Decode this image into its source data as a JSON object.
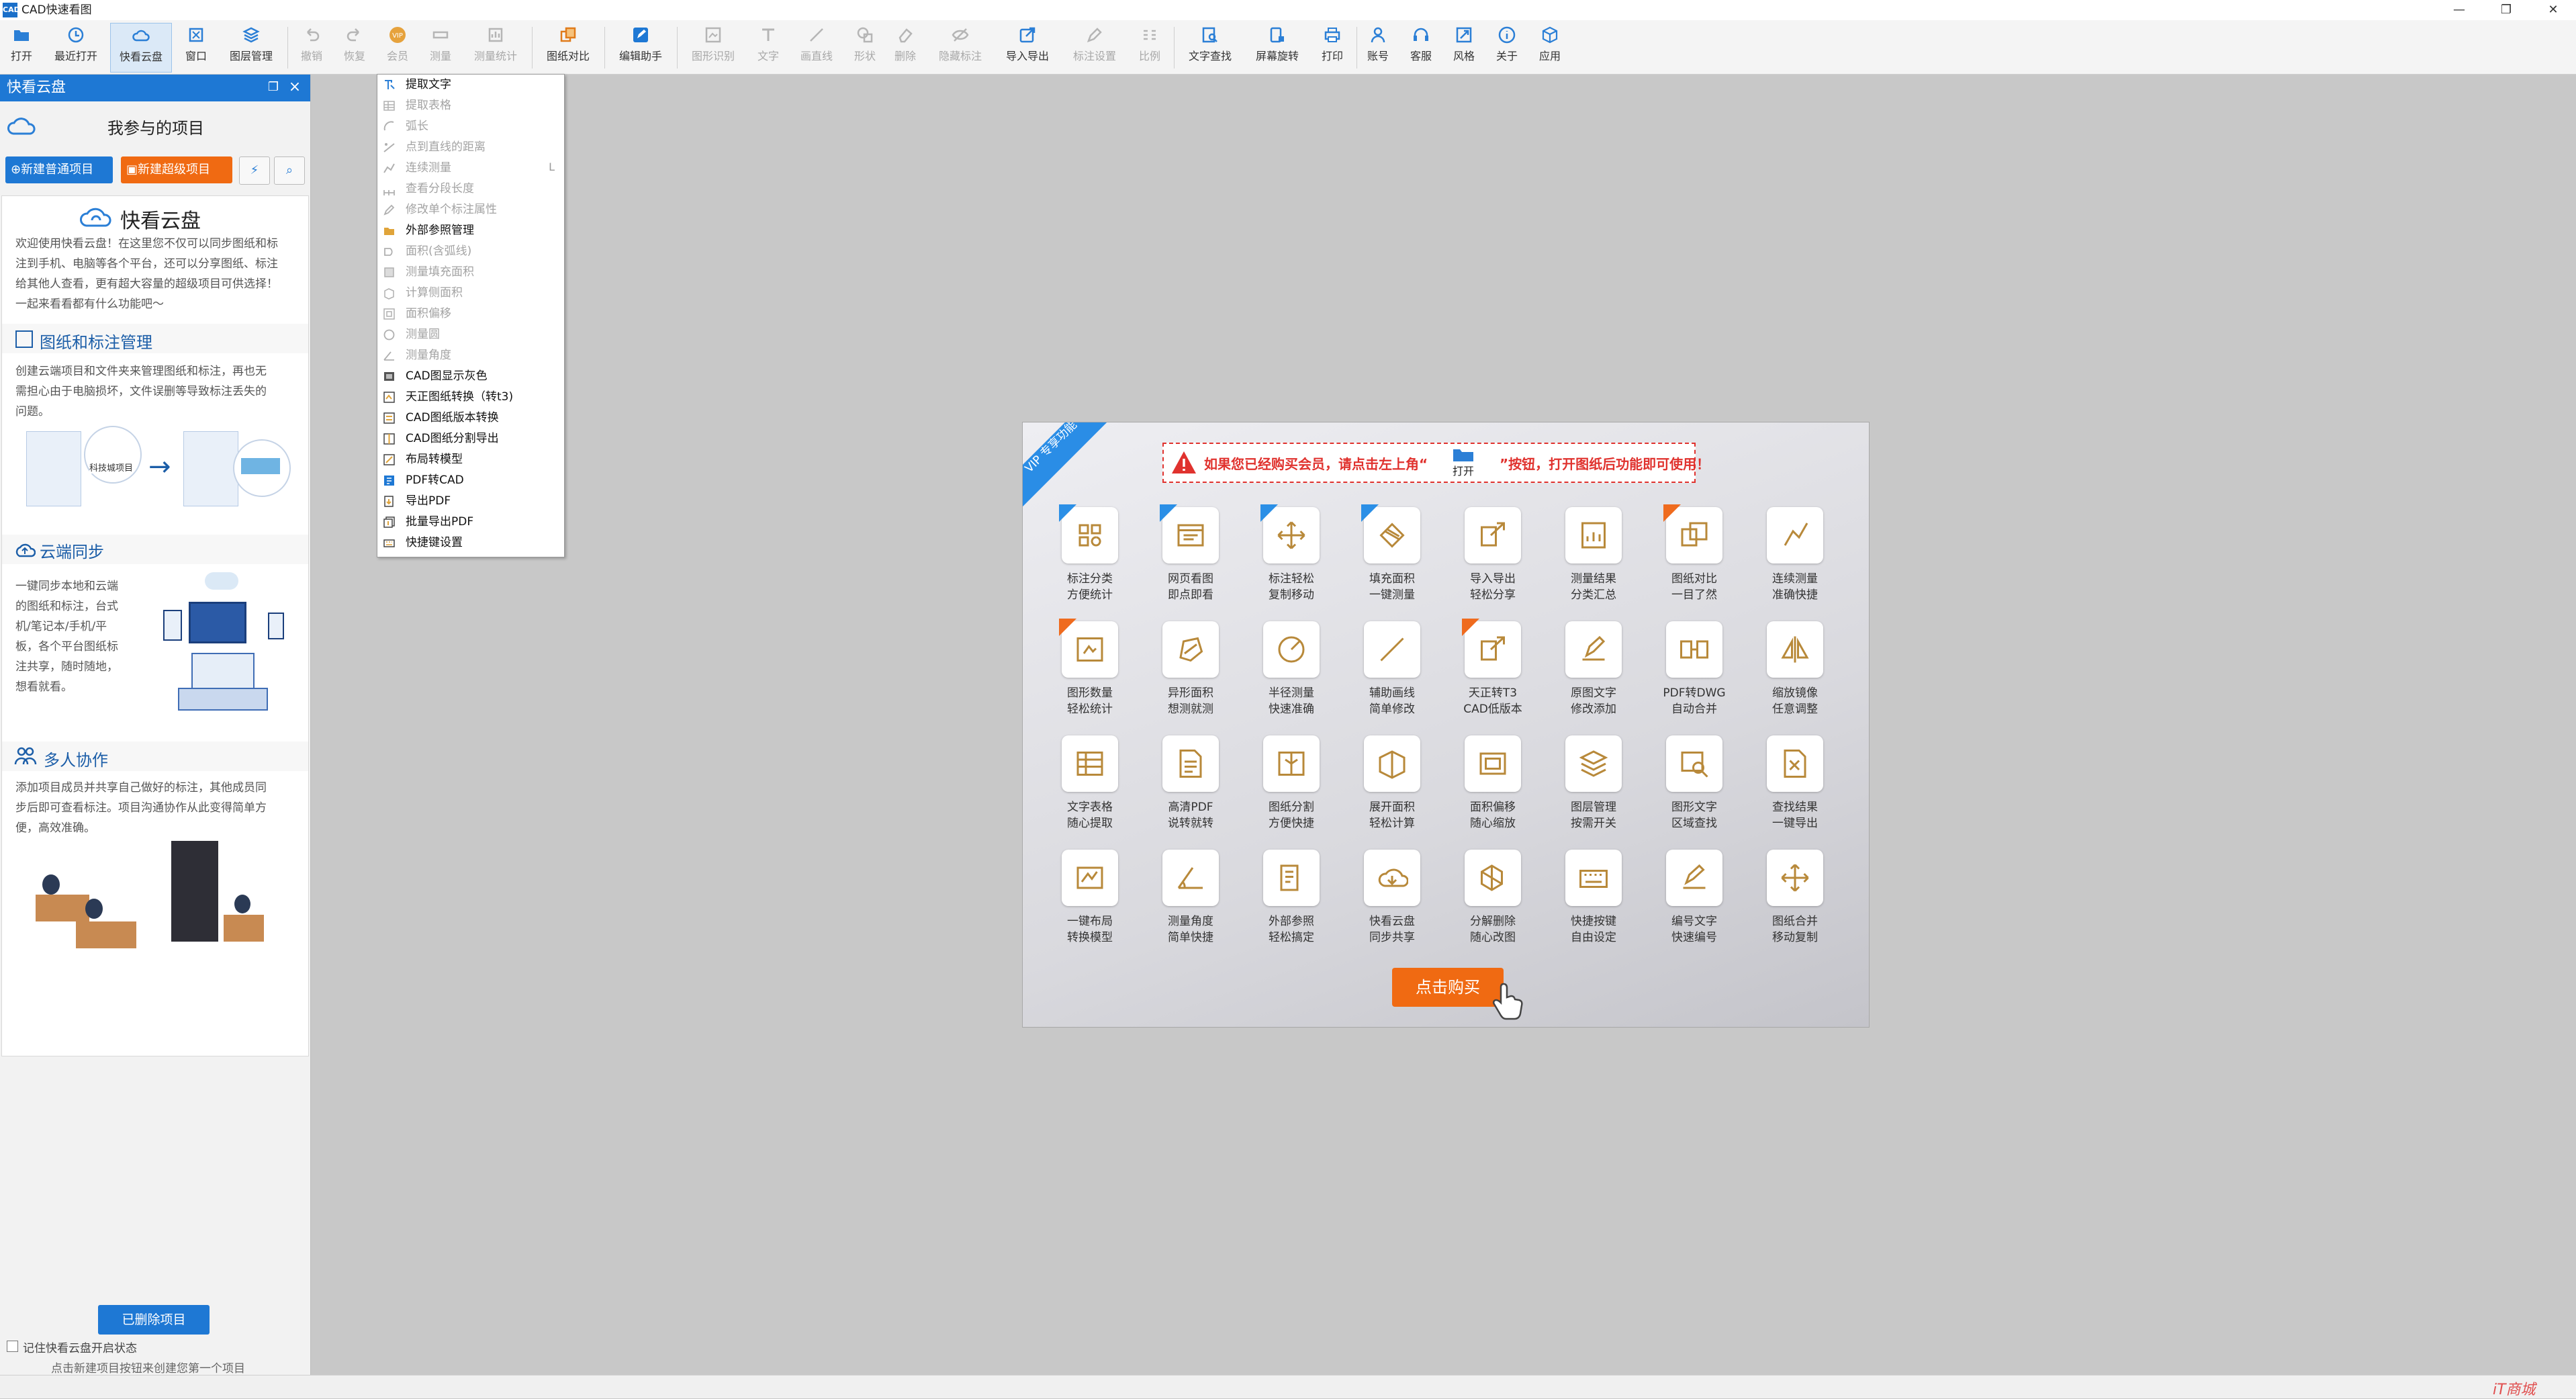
{
  "app": {
    "icon_text": "CAD",
    "title": "CAD快速看图"
  },
  "window": {
    "minimize": "—",
    "restore": "❐",
    "close": "✕"
  },
  "toolbar": [
    {
      "label": "打开",
      "icon": "folder-icon",
      "enabled": true
    },
    {
      "label": "最近打开",
      "icon": "clock-icon",
      "enabled": true
    },
    {
      "label": "快看云盘",
      "icon": "cloud-icon",
      "enabled": true,
      "active": true
    },
    {
      "label": "窗口",
      "icon": "window-icon",
      "enabled": true
    },
    {
      "label": "图层管理",
      "icon": "layers-icon",
      "enabled": true
    },
    {
      "label": "撤销",
      "icon": "undo-icon",
      "enabled": false
    },
    {
      "label": "恢复",
      "icon": "redo-icon",
      "enabled": false
    },
    {
      "label": "会员",
      "icon": "vip-icon",
      "enabled": false
    },
    {
      "label": "测量",
      "icon": "measure-icon",
      "enabled": false
    },
    {
      "label": "测量统计",
      "icon": "measure-stats-icon",
      "enabled": false
    },
    {
      "label": "图纸对比",
      "icon": "compare-icon",
      "enabled": true
    },
    {
      "label": "编辑助手",
      "icon": "edit-assistant-icon",
      "enabled": true
    },
    {
      "label": "图形识别",
      "icon": "shape-recognize-icon",
      "enabled": false
    },
    {
      "label": "文字",
      "icon": "text-icon",
      "enabled": false
    },
    {
      "label": "画直线",
      "icon": "line-icon",
      "enabled": false
    },
    {
      "label": "形状",
      "icon": "shape-icon",
      "enabled": false
    },
    {
      "label": "删除",
      "icon": "erase-icon",
      "enabled": false
    },
    {
      "label": "隐藏标注",
      "icon": "hide-annotation-icon",
      "enabled": false
    },
    {
      "label": "导入导出",
      "icon": "import-export-icon",
      "enabled": true
    },
    {
      "label": "标注设置",
      "icon": "annotation-settings-icon",
      "enabled": false
    },
    {
      "label": "比例",
      "icon": "scale-icon",
      "enabled": false
    },
    {
      "label": "文字查找",
      "icon": "text-search-icon",
      "enabled": true
    },
    {
      "label": "屏幕旋转",
      "icon": "rotate-screen-icon",
      "enabled": true
    },
    {
      "label": "打印",
      "icon": "printer-icon",
      "enabled": true
    },
    {
      "label": "账号",
      "icon": "account-icon",
      "enabled": true
    },
    {
      "label": "客服",
      "icon": "headset-icon",
      "enabled": true
    },
    {
      "label": "风格",
      "icon": "style-icon",
      "enabled": true
    },
    {
      "label": "关于",
      "icon": "info-icon",
      "enabled": true
    },
    {
      "label": "应用",
      "icon": "apps-icon",
      "enabled": true
    }
  ],
  "panel": {
    "title": "快看云盘",
    "project_title": "我参与的项目",
    "new_normal": "新建普通项目",
    "new_super": "新建超级项目",
    "card_title": "快看云盘",
    "intro": [
      "欢迎使用快看云盘！在这里您不仅可以同步图纸和标",
      "注到手机、电脑等各个平台，还可以分享图纸、标注",
      "给其他人查看，更有超大容量的超级项目可供选择！",
      "一起来看看都有什么功能吧～"
    ],
    "sec1_title": "图纸和标注管理",
    "sec1_text": [
      "创建云端项目和文件夹来管理图纸和标注，再也无",
      "需担心由于电脑损坏，文件误删等导致标注丢失的",
      "问题。"
    ],
    "sec1_thumb_label": "科技城项目",
    "sec2_title": "云端同步",
    "sec2_text": [
      "一键同步本地和云端",
      "的图纸和标注，台式",
      "机/笔记本/手机/平",
      "板，各个平台图纸标",
      "注共享，随时随地，",
      "想看就看。"
    ],
    "sec3_title": "多人协作",
    "sec3_text": [
      "添加项目成员并共享自己做好的标注，其他成员同",
      "步后即可查看标注。项目沟通协作从此变得简单方",
      "便，高效准确。"
    ],
    "deleted_btn": "已删除项目",
    "remember": "记住快看云盘开启状态",
    "hint": "点击新建项目按钮来创建您第一个项目"
  },
  "menu": [
    {
      "label": "提取文字",
      "enabled": true,
      "icon": "extract-text-icon"
    },
    {
      "label": "提取表格",
      "enabled": false,
      "icon": "extract-table-icon"
    },
    {
      "label": "弧长",
      "enabled": false,
      "icon": "arc-length-icon"
    },
    {
      "label": "点到直线的距离",
      "enabled": false,
      "icon": "point-line-distance-icon"
    },
    {
      "label": "连续测量",
      "enabled": false,
      "icon": "continuous-measure-icon",
      "shortcut": "L"
    },
    {
      "label": "查看分段长度",
      "enabled": false,
      "icon": "segment-length-icon"
    },
    {
      "label": "修改单个标注属性",
      "enabled": false,
      "icon": "edit-annotation-icon"
    },
    {
      "label": "外部参照管理",
      "enabled": true,
      "icon": "xref-icon"
    },
    {
      "label": "面积(含弧线)",
      "enabled": false,
      "icon": "area-arc-icon"
    },
    {
      "label": "测量填充面积",
      "enabled": false,
      "icon": "fill-area-icon"
    },
    {
      "label": "计算侧面积",
      "enabled": false,
      "icon": "side-area-icon"
    },
    {
      "label": "面积偏移",
      "enabled": false,
      "icon": "area-offset-icon"
    },
    {
      "label": "测量圆",
      "enabled": false,
      "icon": "measure-circle-icon"
    },
    {
      "label": "测量角度",
      "enabled": false,
      "icon": "measure-angle-icon"
    },
    {
      "label": "CAD图显示灰色",
      "enabled": true,
      "icon": "gray-display-icon"
    },
    {
      "label": "天正图纸转换（转t3)",
      "enabled": true,
      "icon": "tangent-convert-icon"
    },
    {
      "label": "CAD图纸版本转换",
      "enabled": true,
      "icon": "version-convert-icon"
    },
    {
      "label": "CAD图纸分割导出",
      "enabled": true,
      "icon": "split-export-icon"
    },
    {
      "label": "布局转模型",
      "enabled": true,
      "icon": "layout-model-icon"
    },
    {
      "label": "PDF转CAD",
      "enabled": true,
      "icon": "pdf-cad-icon"
    },
    {
      "label": "导出PDF",
      "enabled": true,
      "icon": "export-pdf-icon"
    },
    {
      "label": "批量导出PDF",
      "enabled": true,
      "icon": "batch-pdf-icon"
    },
    {
      "label": "快捷键设置",
      "enabled": true,
      "icon": "shortcut-icon"
    }
  ],
  "vip": {
    "corner": "VIP 专享功能",
    "notice_a": "如果您已经购买会员，请点击左上角“",
    "notice_open": "打开",
    "notice_b": "”按钮，打开图纸后功能即可使用！",
    "buy": "点击购买",
    "features": [
      {
        "l1": "标注分类",
        "l2": "方便统计",
        "icon": "annotation-category-icon",
        "badge": "new"
      },
      {
        "l1": "网页看图",
        "l2": "即点即看",
        "icon": "web-view-icon",
        "badge": "new"
      },
      {
        "l1": "标注轻松",
        "l2": "复制移动",
        "icon": "move-copy-icon",
        "badge": "new"
      },
      {
        "l1": "填充面积",
        "l2": "一键测量",
        "icon": "fill-measure-icon",
        "badge": "new"
      },
      {
        "l1": "导入导出",
        "l2": "轻松分享",
        "icon": "import-share-icon",
        "badge": ""
      },
      {
        "l1": "测量结果",
        "l2": "分类汇总",
        "icon": "result-summary-icon",
        "badge": ""
      },
      {
        "l1": "图纸对比",
        "l2": "一目了然",
        "icon": "compare-feature-icon",
        "badge": "hot"
      },
      {
        "l1": "连续测量",
        "l2": "准确快捷",
        "icon": "continuous-feature-icon",
        "badge": ""
      },
      {
        "l1": "图形数量",
        "l2": "轻松统计",
        "icon": "shape-count-icon",
        "badge": "hot"
      },
      {
        "l1": "异形面积",
        "l2": "想测就测",
        "icon": "irregular-area-icon",
        "badge": ""
      },
      {
        "l1": "半径测量",
        "l2": "快速准确",
        "icon": "radius-icon",
        "badge": ""
      },
      {
        "l1": "辅助画线",
        "l2": "简单修改",
        "icon": "assist-line-icon",
        "badge": ""
      },
      {
        "l1": "天正转T3",
        "l2": "CAD低版本",
        "icon": "t3-convert-icon",
        "badge": "hot"
      },
      {
        "l1": "原图文字",
        "l2": "修改添加",
        "icon": "text-edit-icon",
        "badge": ""
      },
      {
        "l1": "PDF转DWG",
        "l2": "自动合并",
        "icon": "pdf-dwg-icon",
        "badge": ""
      },
      {
        "l1": "缩放镜像",
        "l2": "任意调整",
        "icon": "mirror-icon",
        "badge": ""
      },
      {
        "l1": "文字表格",
        "l2": "随心提取",
        "icon": "table-extract-icon",
        "badge": ""
      },
      {
        "l1": "高清PDF",
        "l2": "说转就转",
        "icon": "hd-pdf-icon",
        "badge": ""
      },
      {
        "l1": "图纸分割",
        "l2": "方便快捷",
        "icon": "split-icon",
        "badge": ""
      },
      {
        "l1": "展开面积",
        "l2": "轻松计算",
        "icon": "unfold-area-icon",
        "badge": ""
      },
      {
        "l1": "面积偏移",
        "l2": "随心缩放",
        "icon": "area-offset-feature-icon",
        "badge": ""
      },
      {
        "l1": "图层管理",
        "l2": "按需开关",
        "icon": "layer-feature-icon",
        "badge": ""
      },
      {
        "l1": "图形文字",
        "l2": "区域查找",
        "icon": "region-search-icon",
        "badge": ""
      },
      {
        "l1": "查找结果",
        "l2": "一键导出",
        "icon": "export-result-icon",
        "badge": ""
      },
      {
        "l1": "一键布局",
        "l2": "转换模型",
        "icon": "layout-convert-icon",
        "badge": ""
      },
      {
        "l1": "测量角度",
        "l2": "简单快捷",
        "icon": "angle-feature-icon",
        "badge": ""
      },
      {
        "l1": "外部参照",
        "l2": "轻松搞定",
        "icon": "xref-feature-icon",
        "badge": ""
      },
      {
        "l1": "快看云盘",
        "l2": "同步共享",
        "icon": "cloud-feature-icon",
        "badge": ""
      },
      {
        "l1": "分解删除",
        "l2": "随心改图",
        "icon": "explode-icon",
        "badge": ""
      },
      {
        "l1": "快捷按键",
        "l2": "自由设定",
        "icon": "keyboard-icon",
        "badge": ""
      },
      {
        "l1": "编号文字",
        "l2": "快速编号",
        "icon": "numbering-icon",
        "badge": ""
      },
      {
        "l1": "图纸合并",
        "l2": "移动复制",
        "icon": "merge-icon",
        "badge": ""
      }
    ]
  },
  "watermark": "iT商城"
}
